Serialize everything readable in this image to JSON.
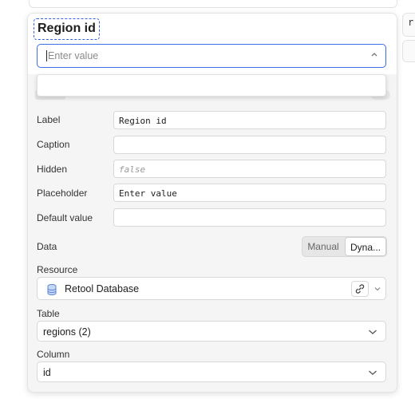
{
  "edge_chip_text": "r",
  "component": {
    "title": "Region id",
    "select_placeholder": "Enter value"
  },
  "fields": {
    "label": {
      "label": "Label",
      "value": "Region id"
    },
    "caption": {
      "label": "Caption",
      "value": ""
    },
    "hidden": {
      "label": "Hidden",
      "placeholder": "false"
    },
    "placeholder": {
      "label": "Placeholder",
      "value": "Enter value"
    },
    "default_value": {
      "label": "Default value",
      "value": ""
    }
  },
  "data_source": {
    "label": "Data",
    "options": [
      "Manual",
      "Dyna..."
    ],
    "selected": "Dyna..."
  },
  "resource": {
    "label": "Resource",
    "value": "Retool Database",
    "icon": "database-icon"
  },
  "table": {
    "label": "Table",
    "value": "regions (2)"
  },
  "column": {
    "label": "Column",
    "value": "id"
  },
  "colors": {
    "accent": "#3b6fe4",
    "panel_bg": "#f5f5f5"
  }
}
